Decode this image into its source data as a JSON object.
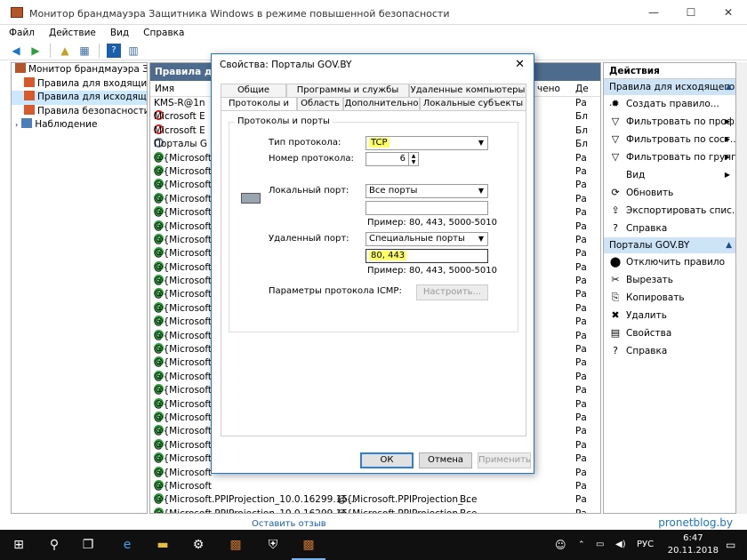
{
  "window": {
    "title": "Монитор брандмауэра Защитника Windows в режиме повышенной безопасности",
    "minimize": "—",
    "maximize": "☐",
    "close": "✕"
  },
  "menu": [
    "Файл",
    "Действие",
    "Вид",
    "Справка"
  ],
  "tree": {
    "root": "Монитор брандмауэра Защит",
    "items": [
      "Правила для входящих по",
      "Правила для исходящего п",
      "Правила безопасности по,",
      "Наблюдение"
    ]
  },
  "center": {
    "header": "Правила для",
    "columns": {
      "name": "Имя",
      "col2": "чено",
      "col3": "Де"
    },
    "rows": [
      {
        "status": "none",
        "name": "KMS-R@1n",
        "c3": "Ра"
      },
      {
        "status": "block",
        "name": "Microsoft E",
        "c3": "Бл"
      },
      {
        "status": "block",
        "name": "Microsoft E",
        "c3": "Бл"
      },
      {
        "status": "disabled",
        "name": "Порталы G",
        "c3": "Бл"
      },
      {
        "status": "ok",
        "name": "@{Microsoft",
        "c3": "Ра"
      },
      {
        "status": "ok",
        "name": "@{Microsoft",
        "c3": "Ра"
      },
      {
        "status": "ok",
        "name": "@{Microsoft",
        "c3": "Ра"
      },
      {
        "status": "ok",
        "name": "@{Microsoft",
        "c3": "Ра"
      },
      {
        "status": "ok",
        "name": "@{Microsoft",
        "c3": "Ра"
      },
      {
        "status": "ok",
        "name": "@{Microsoft",
        "c3": "Ра"
      },
      {
        "status": "ok",
        "name": "@{Microsoft",
        "c3": "Ра"
      },
      {
        "status": "ok",
        "name": "@{Microsoft",
        "c3": "Ра"
      },
      {
        "status": "ok",
        "name": "@{Microsoft",
        "c3": "Ра"
      },
      {
        "status": "ok",
        "name": "@{Microsoft",
        "c3": "Ра"
      },
      {
        "status": "ok",
        "name": "@{Microsoft",
        "c3": "Ра"
      },
      {
        "status": "ok",
        "name": "@{Microsoft",
        "c3": "Ра"
      },
      {
        "status": "ok",
        "name": "@{Microsoft",
        "c3": "Ра"
      },
      {
        "status": "ok",
        "name": "@{Microsoft",
        "c3": "Ра"
      },
      {
        "status": "ok",
        "name": "@{Microsoft",
        "c3": "Ра"
      },
      {
        "status": "ok",
        "name": "@{Microsoft",
        "c3": "Ра"
      },
      {
        "status": "ok",
        "name": "@{Microsoft",
        "c3": "Ра"
      },
      {
        "status": "ok",
        "name": "@{Microsoft",
        "c3": "Ра"
      },
      {
        "status": "ok",
        "name": "@{Microsoft",
        "c3": "Ра"
      },
      {
        "status": "ok",
        "name": "@{Microsoft",
        "c3": "Ра"
      },
      {
        "status": "ok",
        "name": "@{Microsoft",
        "c3": "Ра"
      },
      {
        "status": "ok",
        "name": "@{Microsoft",
        "c3": "Ра"
      },
      {
        "status": "ok",
        "name": "@{Microsoft",
        "c3": "Ра"
      },
      {
        "status": "ok",
        "name": "@{Microsoft",
        "c3": "Ра"
      },
      {
        "status": "ok",
        "name": "@{Microsoft",
        "c3": "Ра"
      },
      {
        "status": "ok",
        "name": "@{Microsoft.PPIProjection_10.0.16299.15...",
        "c2": "@{Microsoft.PPIProjection_...",
        "c2b": "Все",
        "c3": "Ра"
      },
      {
        "status": "ok",
        "name": "@{Microsoft.PPIProjection_10.0.16299.15...",
        "c2": "@{Microsoft.PPIProjection_...",
        "c2b": "Все",
        "c3": "Ра"
      }
    ]
  },
  "actions": {
    "header": "Действия",
    "section1": "Правила для исходящего ...",
    "items1": [
      {
        "icon": "✹",
        "label": "Создать правило...",
        "sub": ""
      },
      {
        "icon": "▽",
        "label": "Фильтровать по проф...",
        "sub": "▶"
      },
      {
        "icon": "▽",
        "label": "Фильтровать по сост...",
        "sub": "▶"
      },
      {
        "icon": "▽",
        "label": "Фильтровать по группе",
        "sub": "▶"
      },
      {
        "icon": "",
        "label": "Вид",
        "sub": "▶"
      },
      {
        "icon": "⟳",
        "label": "Обновить",
        "sub": ""
      },
      {
        "icon": "⇪",
        "label": "Экспортировать спис...",
        "sub": ""
      },
      {
        "icon": "?",
        "label": "Справка",
        "sub": ""
      }
    ],
    "section2": "Порталы GOV.BY",
    "items2": [
      {
        "icon": "⬤",
        "label": "Отключить правило"
      },
      {
        "icon": "✂",
        "label": "Вырезать"
      },
      {
        "icon": "⎘",
        "label": "Копировать"
      },
      {
        "icon": "✖",
        "label": "Удалить"
      },
      {
        "icon": "▤",
        "label": "Свойства"
      },
      {
        "icon": "?",
        "label": "Справка"
      }
    ]
  },
  "dialog": {
    "title": "Свойства: Порталы GOV.BY",
    "close": "✕",
    "tabs_row1": [
      "Общие",
      "Программы и службы",
      "Удаленные компьютеры"
    ],
    "tabs_row2": [
      "Протоколы и порты",
      "Область",
      "Дополнительно",
      "Локальные субъекты"
    ],
    "group_label": "Протоколы и порты",
    "protocol_type_label": "Тип протокола:",
    "protocol_type_value": "TCP",
    "protocol_number_label": "Номер протокола:",
    "protocol_number_value": "6",
    "local_port_label": "Локальный порт:",
    "local_port_value": "Все порты",
    "local_port_text": "",
    "example1": "Пример: 80, 443, 5000-5010",
    "remote_port_label": "Удаленный порт:",
    "remote_port_value": "Специальные порты",
    "remote_port_text": "80, 443",
    "example2": "Пример: 80, 443, 5000-5010",
    "icmp_label": "Параметры протокола ICMP:",
    "icmp_button": "Настроить...",
    "ok": "ОК",
    "cancel": "Отмена",
    "apply": "Применить"
  },
  "bottom_link": "Оставить отзыв",
  "taskbar": {
    "lang": "РУС",
    "time": "6:47",
    "date": "20.11.2018"
  },
  "watermark": "pronetblog.by"
}
